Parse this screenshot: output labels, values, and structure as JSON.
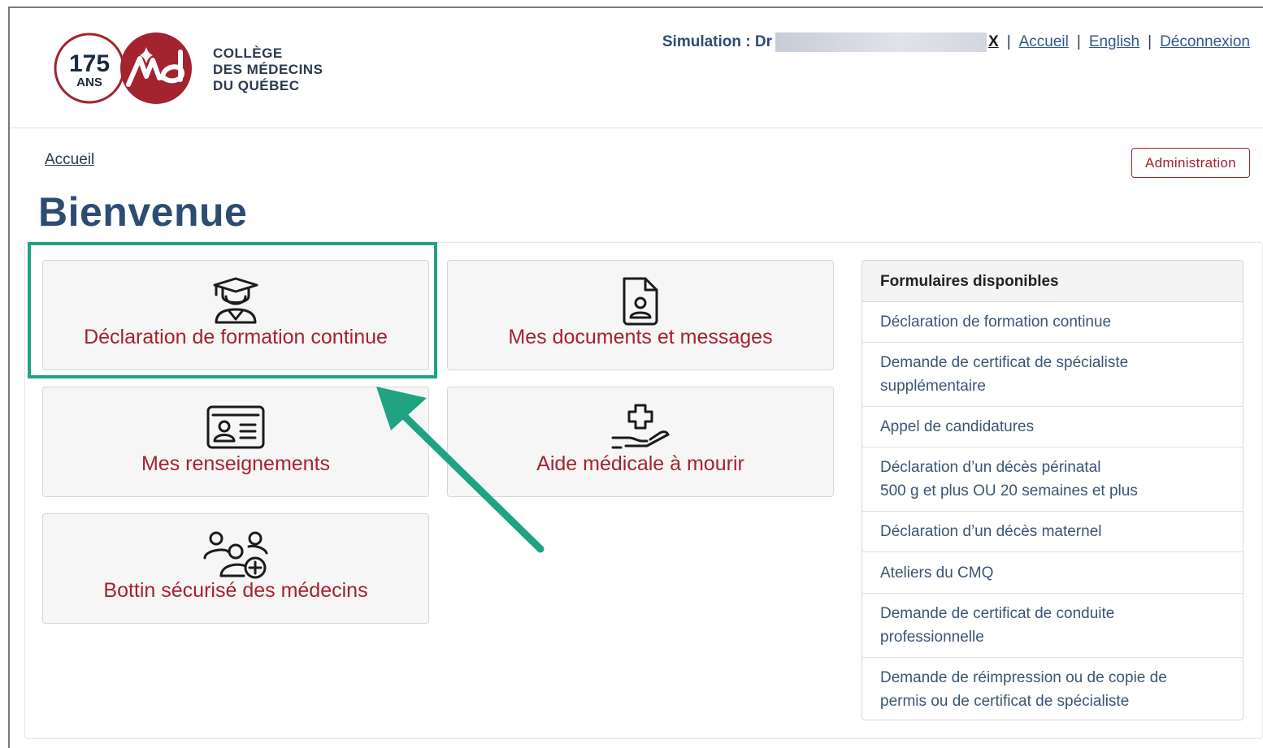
{
  "header": {
    "logo": {
      "badge_number": "175",
      "badge_sub": "ANS",
      "name_lines": [
        "COLLÈGE",
        "DES MÉDECINS",
        "DU QUÉBEC"
      ]
    },
    "nav": {
      "simulation_label": "Simulation : Dr",
      "close_label": "X",
      "separator": "|",
      "links": [
        "Accueil",
        "English",
        "Déconnexion"
      ]
    }
  },
  "breadcrumb": "Accueil",
  "admin_button": "Administration",
  "page_title": "Bienvenue",
  "tiles": [
    {
      "label": "Déclaration de formation continue",
      "icon": "graduate-icon"
    },
    {
      "label": "Mes documents et messages",
      "icon": "document-user-icon"
    },
    {
      "label": "Mes renseignements",
      "icon": "id-card-icon"
    },
    {
      "label": "Aide médicale à mourir",
      "icon": "hand-cross-icon"
    },
    {
      "label": "Bottin sécurisé des médecins",
      "icon": "users-plus-icon"
    }
  ],
  "forms": {
    "title": "Formulaires disponibles",
    "items": [
      [
        "Déclaration de formation continue"
      ],
      [
        "Demande de certificat de spécialiste",
        "supplémentaire"
      ],
      [
        "Appel de candidatures"
      ],
      [
        "Déclaration d’un décès périnatal",
        "500 g et plus OU 20 semaines et plus"
      ],
      [
        "Déclaration d’un décès maternel"
      ],
      [
        "Ateliers du CMQ"
      ],
      [
        "Demande de certificat de conduite",
        "professionnelle"
      ],
      [
        "Demande de réimpression ou de copie de",
        "permis ou de certificat de spécialiste"
      ]
    ]
  },
  "colors": {
    "brand_red": "#a3232f",
    "title_blue": "#2d4c73",
    "highlight_green": "#1fa383"
  }
}
